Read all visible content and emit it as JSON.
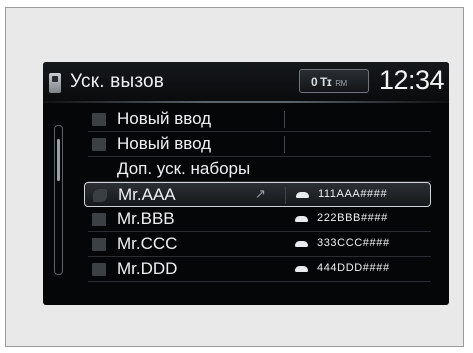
{
  "header": {
    "title": "Уск. вызов",
    "status": "0 Tɪ",
    "status_sub": "RM",
    "clock": "12:34"
  },
  "list": [
    {
      "name": "Новый ввод",
      "number": "",
      "icon": "new-entry-icon"
    },
    {
      "name": "Новый ввод",
      "number": "",
      "icon": "new-entry-icon"
    },
    {
      "name": "Доп. уск. наборы",
      "number": "",
      "icon": ""
    },
    {
      "name": "Mr.AAA",
      "number": "111AAA####",
      "icon": "handset-icon",
      "selected": true,
      "voice_tag": true
    },
    {
      "name": "Mr.BBB",
      "number": "222BBB####",
      "icon": "new-entry-icon"
    },
    {
      "name": "Mr.CCC",
      "number": "333CCC####",
      "icon": "new-entry-icon"
    },
    {
      "name": "Mr.DDD",
      "number": "444DDD####",
      "icon": "new-entry-icon"
    }
  ],
  "scroll": {
    "position": 0.1
  }
}
